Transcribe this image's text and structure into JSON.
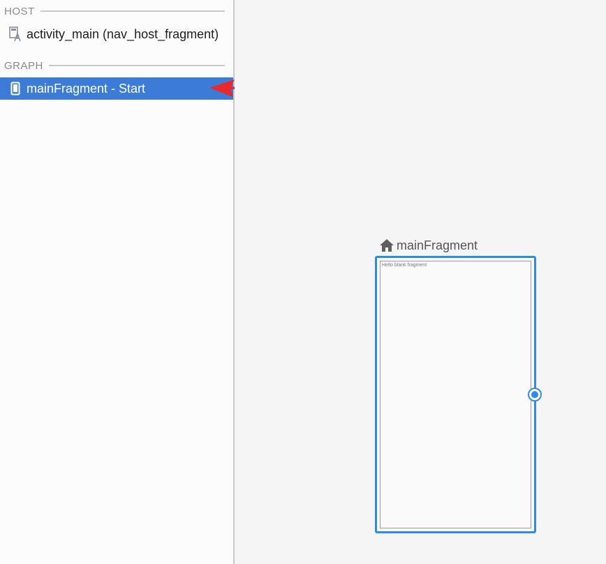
{
  "host_section": {
    "label": "HOST",
    "items": [
      {
        "label": "activity_main (nav_host_fragment)",
        "icon": "layout-file-icon"
      }
    ]
  },
  "graph_section": {
    "label": "GRAPH",
    "items": [
      {
        "label": "mainFragment - Start",
        "icon": "fragment-phone-icon",
        "selected": true
      }
    ]
  },
  "canvas": {
    "destination": {
      "name": "mainFragment",
      "start_icon": "home-icon",
      "preview_text": "Hello blank fragment"
    }
  },
  "colors": {
    "selection": "#3d7bd9",
    "accent": "#2f8be6",
    "annotation_arrow": "#e8282b",
    "canvas_bg": "#f5f5f5",
    "panel_bg": "#fcfcfc"
  }
}
